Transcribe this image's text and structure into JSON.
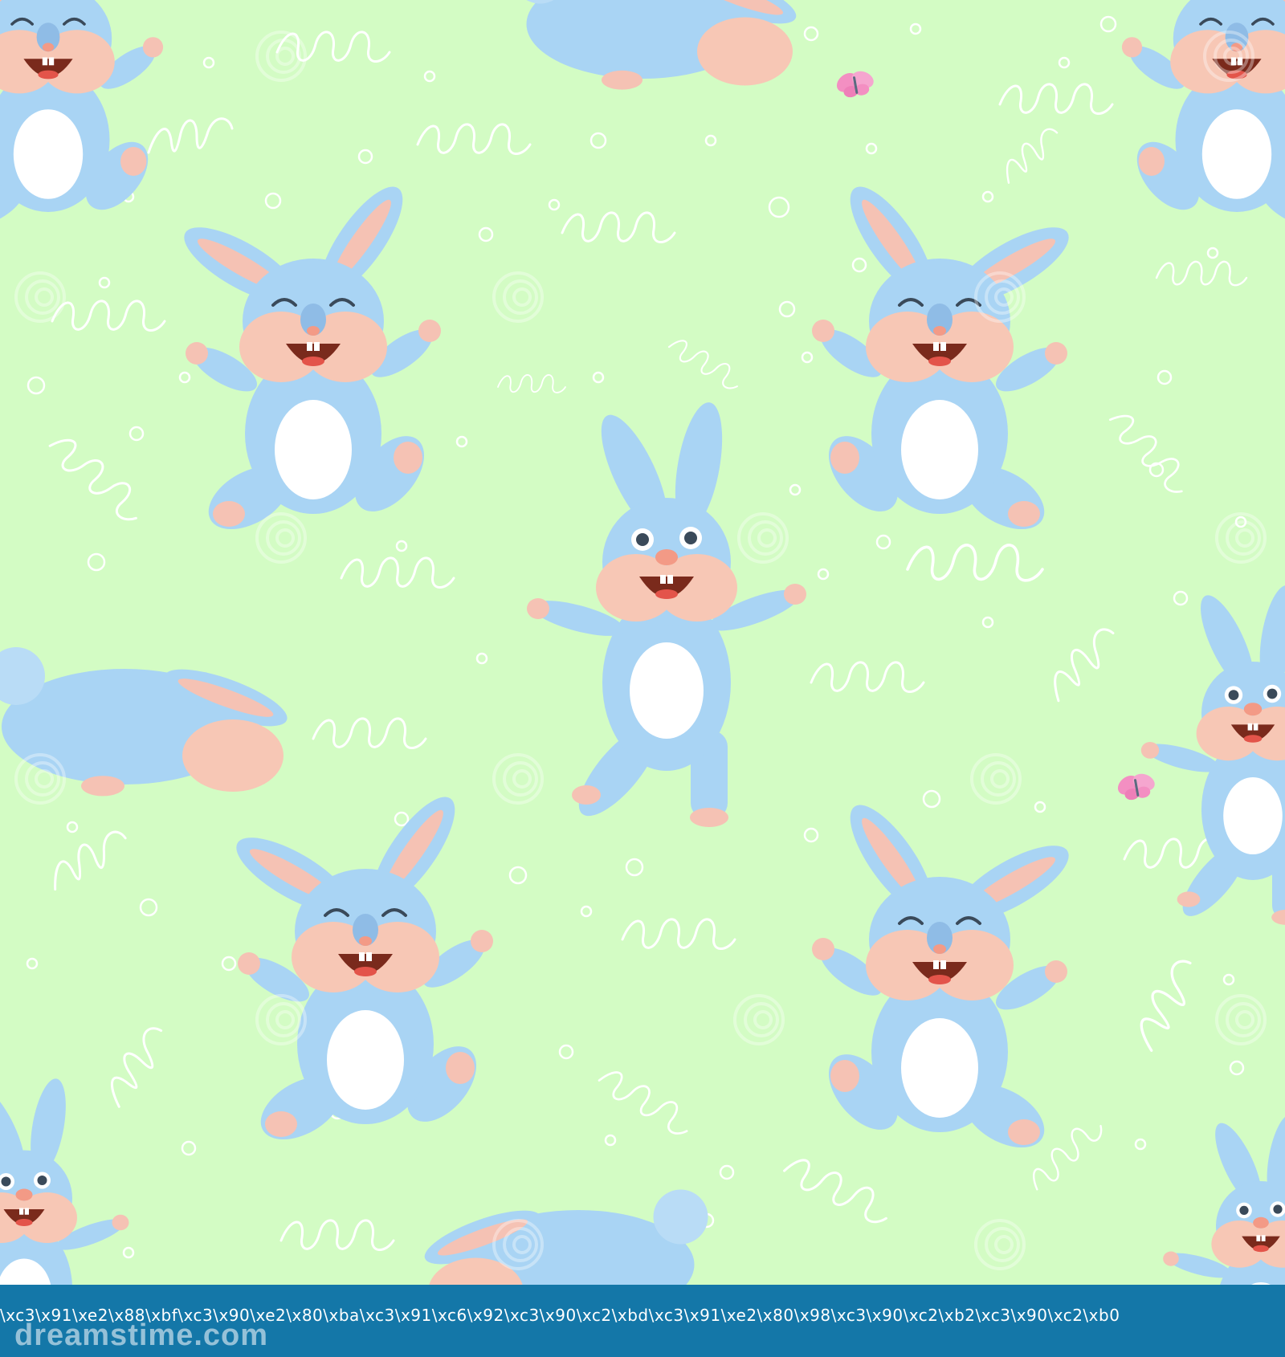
{
  "colors": {
    "background": "#d3fcc4",
    "footer": "#1477a8",
    "bunny_body": "#a9d4f4",
    "bunny_shade": "#94c4ea",
    "ear_inner": "#f5c2b4",
    "cheek": "#f7c7b5",
    "belly": "#ffffff",
    "mouth": "#7a2a1c",
    "butterfly": "#f38fc2",
    "doodle": "#ffffff"
  },
  "footer": {
    "caption": "\\xc3\\x91\\xe2\\x88\\xbf\\xc3\\x90\\xe2\\x80\\xba\\xc3\\x91\\xc6\\x92\\xc3\\x90\\xc2\\xbd\\xc3\\x91\\xe2\\x80\\x98\\xc3\\x90\\xc2\\xb2\\xc3\\x90\\xc2\\xb0",
    "logo": "dreamstime.com"
  },
  "icons": {
    "bunny": "bunny-icon",
    "butterfly": "butterfly-icon",
    "watermark": "dreamstime-spiral-icon"
  }
}
